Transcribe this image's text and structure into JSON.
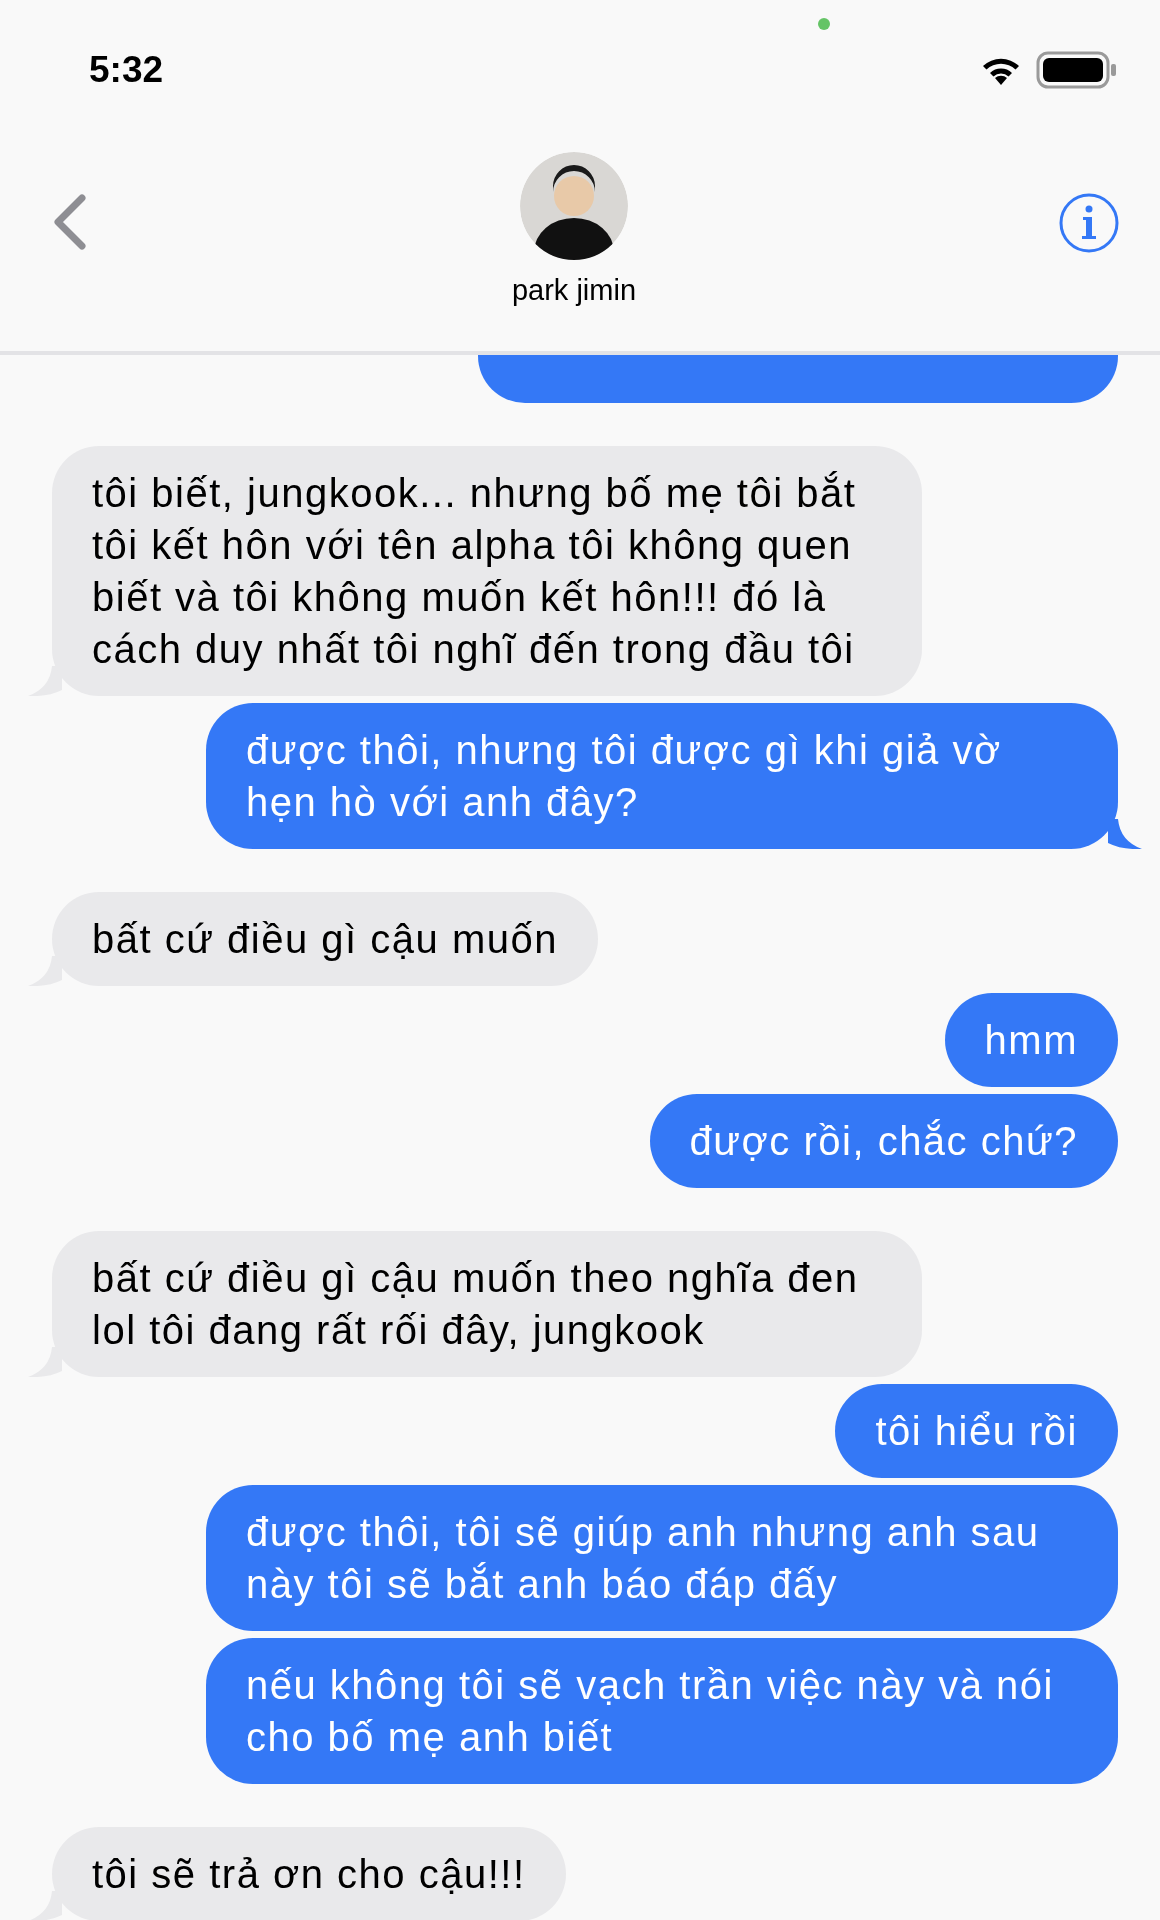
{
  "status_bar": {
    "time": "5:32"
  },
  "header": {
    "contact_name": "park jimin"
  },
  "messages": [
    {
      "kind": "sent",
      "tail": false
    },
    {
      "kind": "received",
      "text": "tôi biết, jungkook... nhưng bố mẹ tôi bắt tôi kết hôn với tên alpha tôi không quen biết và tôi không muốn kết hôn!!! đó là cách duy nhất tôi nghĩ đến trong đầu tôi",
      "tail": true
    },
    {
      "kind": "sent",
      "text": "được thôi, nhưng tôi được gì khi giả vờ hẹn hò với anh đây?",
      "tail": true
    },
    {
      "kind": "received",
      "text": "bất cứ điều gì cậu muốn",
      "tail": true
    },
    {
      "kind": "sent",
      "text": "hmm",
      "tail": false
    },
    {
      "kind": "sent",
      "text": "được rồi, chắc chứ?",
      "tail": false
    },
    {
      "kind": "received",
      "text": "bất cứ điều gì cậu muốn theo nghĩa đen lol tôi đang rất rối đây, jungkook",
      "tail": true
    },
    {
      "kind": "sent",
      "text": "tôi hiểu rồi",
      "tail": false
    },
    {
      "kind": "sent",
      "text": "được thôi, tôi sẽ giúp anh nhưng anh sau này tôi sẽ bắt anh báo đáp đấy",
      "tail": false
    },
    {
      "kind": "sent",
      "text": "nếu không tôi sẽ vạch trần việc này và nói cho bố mẹ anh biết",
      "tail": false
    },
    {
      "kind": "received",
      "text": "tôi sẽ trả ơn cho cậu!!!",
      "tail": true
    }
  ]
}
